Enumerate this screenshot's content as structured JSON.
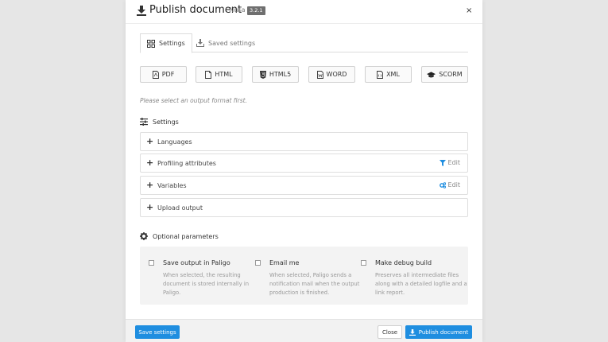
{
  "header": {
    "title": "Publish document",
    "subtitle": "- Nusa",
    "version": "3.2.1",
    "close": "×"
  },
  "tabs": [
    {
      "label": "Settings",
      "icon": "grid-icon"
    },
    {
      "label": "Saved settings",
      "icon": "download-tray-icon"
    }
  ],
  "formats": [
    {
      "label": "PDF",
      "icon": "pdf-file-icon"
    },
    {
      "label": "HTML",
      "icon": "file-icon"
    },
    {
      "label": "HTML5",
      "icon": "html5-icon"
    },
    {
      "label": "WORD",
      "icon": "word-file-icon"
    },
    {
      "label": "XML",
      "icon": "code-file-icon"
    },
    {
      "label": "SCORM",
      "icon": "graduation-cap-icon"
    }
  ],
  "hint": "Please select an output format first.",
  "settings": {
    "title": "Settings",
    "items": [
      {
        "label": "Languages"
      },
      {
        "label": "Profiling attributes",
        "edit": "Edit"
      },
      {
        "label": "Variables",
        "edit": "Edit"
      },
      {
        "label": "Upload output"
      }
    ]
  },
  "optional": {
    "title": "Optional parameters",
    "options": [
      {
        "label": "Save output in Paligo",
        "desc": "When selected, the resulting document is stored internally in Paligo."
      },
      {
        "label": "Email me",
        "desc": "When selected, Paligo sends a notification mail when the output production is finished."
      },
      {
        "label": "Make debug build",
        "desc": "Preserves all intermediate files along with a detailed logfile and a link report."
      }
    ]
  },
  "footer": {
    "save_settings": "Save settings",
    "close": "Close",
    "publish": "Publish document"
  },
  "colors": {
    "primary": "#1f8ee0",
    "accent_icon": "#1f8ee0"
  }
}
